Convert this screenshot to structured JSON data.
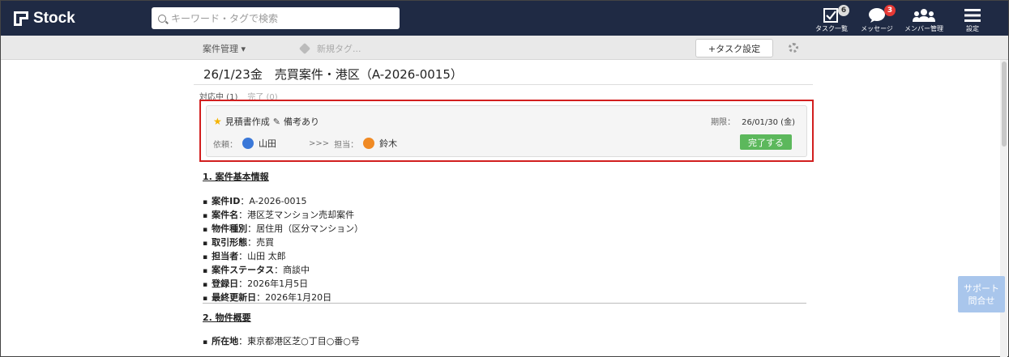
{
  "header": {
    "logo": "Stock",
    "search_placeholder": "キーワード・タグで検索",
    "nav": [
      {
        "label": "タスク一覧",
        "icon": "checkbox-icon",
        "badge": "6"
      },
      {
        "label": "メッセージ",
        "icon": "chat-icon",
        "badge": "3"
      },
      {
        "label": "メンバー管理",
        "icon": "users-icon"
      },
      {
        "label": "設定",
        "icon": "menu-icon"
      }
    ]
  },
  "subbar": {
    "category": "案件管理 ▾",
    "tag_placeholder": "新規タグ...",
    "task_button": "+タスク設定"
  },
  "note": {
    "title": "26/1/23金　売買案件・港区（A-2026-0015）",
    "tabs": {
      "active": "対応中 (1)",
      "inactive": "完了 (0)"
    }
  },
  "task": {
    "name": "見積書作成",
    "memo": "備考あり",
    "deadline_label": "期限：",
    "deadline_value": "26/01/30 (金)",
    "requester_label": "依頼：",
    "requester": "山田",
    "arrow": ">>>",
    "assignee_label": "担当：",
    "assignee": "鈴木",
    "done_button": "完了する"
  },
  "content": {
    "section1": "1. 案件基本情報",
    "items": [
      {
        "k": "案件ID",
        "v": "：A-2026-0015"
      },
      {
        "k": "案件名",
        "v": "：港区芝マンション売却案件"
      },
      {
        "k": "物件種別",
        "v": "：居住用（区分マンション）"
      },
      {
        "k": "取引形態",
        "v": "：売買"
      },
      {
        "k": "担当者",
        "v": "：山田 太郎"
      },
      {
        "k": "案件ステータス",
        "v": "：商談中"
      },
      {
        "k": "登録日",
        "v": "：2026年1月5日"
      },
      {
        "k": "最終更新日",
        "v": "：2026年1月20日"
      }
    ],
    "section2": "2. 物件概要",
    "items2": [
      {
        "k": "所在地",
        "v": "：東京都港区芝○丁目○番○号"
      }
    ]
  },
  "support": {
    "line1": "サポート",
    "line2": "問合せ"
  }
}
